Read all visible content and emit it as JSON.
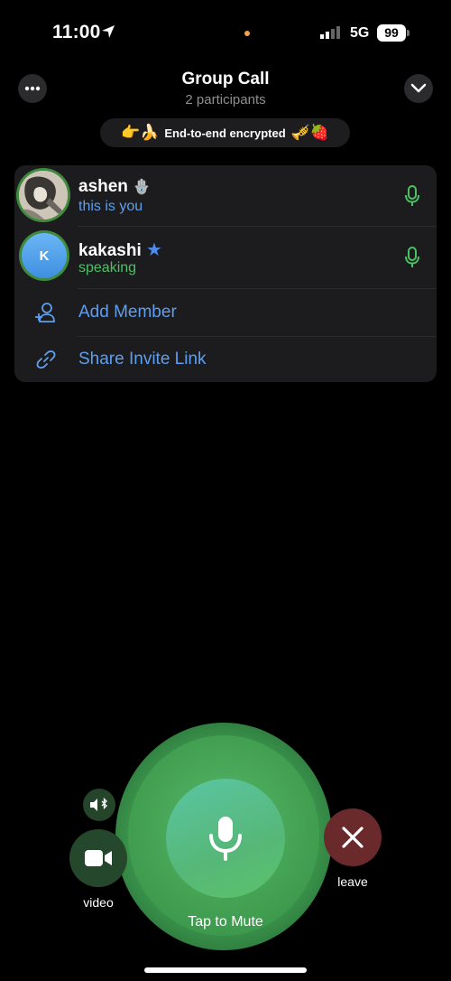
{
  "status_bar": {
    "time": "11:00",
    "network": "5G",
    "battery": "99"
  },
  "header": {
    "title": "Group Call",
    "subtitle": "2 participants"
  },
  "encryption": {
    "emoji_left": "👉🍌",
    "label": "End-to-end encrypted",
    "emoji_right": "🎺🍓"
  },
  "participants": [
    {
      "name": "ashen",
      "name_badge": "🪬",
      "status": "this is you",
      "status_color": "#5e9eef"
    },
    {
      "name": "kakashi",
      "name_badge": "★",
      "status": "speaking",
      "status_color": "#4cc164",
      "initial": "K"
    }
  ],
  "actions": {
    "add_member": "Add Member",
    "share_invite_link": "Share Invite Link"
  },
  "controls": {
    "tap_to_mute": "Tap to Mute",
    "video": "video",
    "leave": "leave"
  },
  "colors": {
    "accent_blue": "#5e9eef",
    "speaking_green": "#4cc164",
    "mute_button": "#56b778",
    "leave_red": "#6a2a2c"
  },
  "icons": [
    "more-icon",
    "chevron-down-icon",
    "mic-icon",
    "add-user-icon",
    "link-icon",
    "speaker-bluetooth-icon",
    "video-camera-icon",
    "close-icon"
  ]
}
